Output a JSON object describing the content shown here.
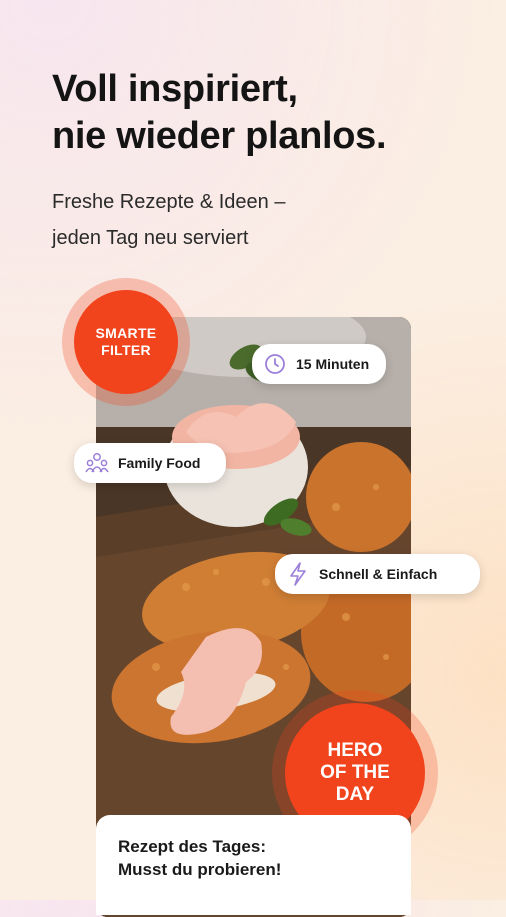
{
  "header": {
    "headline_line1": "Voll inspiriert,",
    "headline_line2": "nie wieder planlos.",
    "sub_line1": "Freshe Rezepte & Ideen –",
    "sub_line2": "jeden Tag neu serviert"
  },
  "badges": {
    "smart_filter_line1": "SMARTE",
    "smart_filter_line2": "FILTER",
    "hero_line1": "HERO",
    "hero_line2": "OF THE",
    "hero_line3": "DAY"
  },
  "chips": {
    "time": {
      "label": "15 Minuten",
      "icon": "clock-icon"
    },
    "family": {
      "label": "Family Food",
      "icon": "family-icon"
    },
    "quick": {
      "label": "Schnell & Einfach",
      "icon": "lightning-icon"
    }
  },
  "recipe_card": {
    "line1": "Rezept des Tages:",
    "line2": "Musst du probieren!"
  },
  "colors": {
    "accent": "#f1431c",
    "icon_lilac": "#9b7fd9"
  }
}
